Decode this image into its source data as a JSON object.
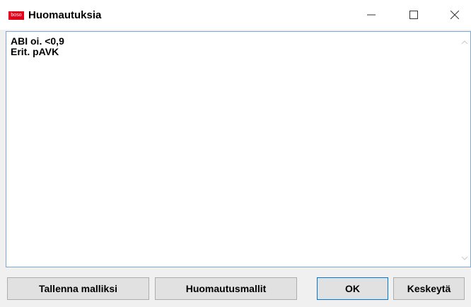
{
  "window": {
    "title": "Huomautuksia",
    "logo_text": "boso",
    "logo_color": "#e2001a"
  },
  "controls": {
    "minimize_icon": "minimize-icon",
    "maximize_icon": "maximize-icon",
    "close_icon": "close-icon"
  },
  "notes": {
    "lines": [
      "ABI oi. <0,9",
      "Erit. pAVK"
    ]
  },
  "buttons": {
    "save_template": "Tallenna malliksi",
    "templates": "Huomautusmallit",
    "ok": "OK",
    "cancel": "Keskeytä"
  },
  "colors": {
    "accent": "#0078d7",
    "text_border": "#7aa7d6"
  }
}
